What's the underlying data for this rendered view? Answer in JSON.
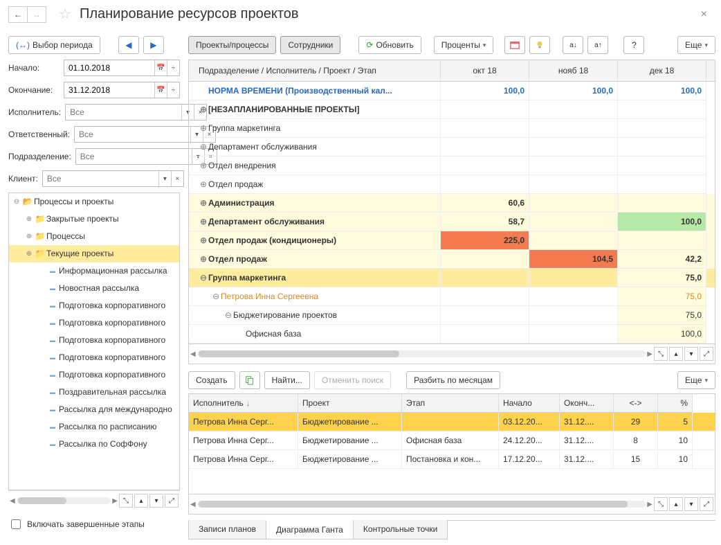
{
  "title": "Планирование ресурсов проектов",
  "toolbar_left": {
    "period_select": "Выбор периода"
  },
  "toolbar_main": {
    "projects": "Проекты/процессы",
    "employees": "Сотрудники",
    "refresh": "Обновить",
    "percents": "Проценты",
    "more": "Еще"
  },
  "period": {
    "start_label": "Начало:",
    "start_value": "01.10.2018",
    "end_label": "Окончание:",
    "end_value": "31.12.2018"
  },
  "filters": {
    "exec_label": "Исполнитель:",
    "resp_label": "Ответственный:",
    "dept_label": "Подразделение:",
    "client_label": "Клиент:",
    "placeholder": "Все"
  },
  "tree": {
    "root": "Процессы и проекты",
    "items": [
      {
        "label": "Закрытые проекты",
        "icon": "folder",
        "exp": "+"
      },
      {
        "label": "Процессы",
        "icon": "folder",
        "exp": "+"
      },
      {
        "label": "Текущие проекты",
        "icon": "folder",
        "exp": "+",
        "sel": true
      },
      {
        "label": "Информационная рассылка",
        "icon": "list"
      },
      {
        "label": "Новостная рассылка",
        "icon": "list"
      },
      {
        "label": "Подготовка корпоративного",
        "icon": "list"
      },
      {
        "label": "Подготовка корпоративного",
        "icon": "list"
      },
      {
        "label": "Подготовка корпоративного",
        "icon": "list"
      },
      {
        "label": "Подготовка корпоративного",
        "icon": "list"
      },
      {
        "label": "Подготовка корпоративного",
        "icon": "list"
      },
      {
        "label": "Поздравительная рассылка",
        "icon": "list"
      },
      {
        "label": "Рассылка для международно",
        "icon": "list"
      },
      {
        "label": "Рассылка по расписанию",
        "icon": "list"
      },
      {
        "label": "Рассылка по СофФону",
        "icon": "list"
      }
    ]
  },
  "include_completed": "Включать завершенные этапы",
  "grid": {
    "head": {
      "main": "Подразделение / Исполнитель / Проект / Этап",
      "m1": "окт 18",
      "m2": "нояб 18",
      "m3": "дек 18"
    },
    "rows": [
      {
        "label": "НОРМА ВРЕМЕНИ (Производственный кал...",
        "v1": "100,0",
        "v2": "100,0",
        "v3": "100,0",
        "style": "blue",
        "indent": 0,
        "exp": ""
      },
      {
        "label": "[НЕЗАПЛАНИРОВАННЫЕ ПРОЕКТЫ]",
        "style": "bold",
        "indent": 0,
        "exp": "⊕"
      },
      {
        "label": "Группа маркетинга",
        "indent": 0,
        "exp": "⊕"
      },
      {
        "label": "Департамент обслуживания",
        "indent": 0,
        "exp": "⊕"
      },
      {
        "label": "Отдел внедрения",
        "indent": 0,
        "exp": "⊕"
      },
      {
        "label": "Отдел продаж",
        "indent": 0,
        "exp": "⊕"
      },
      {
        "label": "Администрация",
        "style": "bold",
        "indent": 0,
        "exp": "⊕",
        "bg": "row-yellow",
        "v1": "60,6",
        "c1": "cell-ly"
      },
      {
        "label": "Департамент обслуживания",
        "style": "bold",
        "indent": 0,
        "exp": "⊕",
        "bg": "row-yellow",
        "v1": "58,7",
        "c1": "cell-ly",
        "v3": "100,0",
        "c3": "cell-green"
      },
      {
        "label": "Отдел продаж (кондиционеры)",
        "style": "bold",
        "indent": 0,
        "exp": "⊕",
        "bg": "row-yellow",
        "v1": "225,0",
        "c1": "cell-orange"
      },
      {
        "label": "Отдел продаж",
        "style": "bold",
        "indent": 0,
        "exp": "⊕",
        "bg": "row-yellow",
        "v2": "104,5",
        "c2": "cell-orange",
        "v3": "42,2",
        "c3": "cell-ly"
      },
      {
        "label": "Группа маркетинга",
        "style": "bold",
        "indent": 0,
        "exp": "⊖",
        "bg": "row-yellow-strong",
        "v3": "75,0",
        "c3": "cell-ly"
      },
      {
        "label": "Петрова Инна Сергеевна",
        "style": "row-orange",
        "indent": 1,
        "exp": "⊖",
        "v3": "75,0",
        "c3": "cell-ly"
      },
      {
        "label": "Бюджетирование проектов",
        "indent": 2,
        "exp": "⊖",
        "v3": "75,0",
        "c3": "cell-ly"
      },
      {
        "label": "Офисная база",
        "indent": 3,
        "v3": "100,0",
        "c3": "cell-ly"
      }
    ]
  },
  "lower_toolbar": {
    "create": "Создать",
    "find": "Найти...",
    "cancel": "Отменить поиск",
    "split": "Разбить по месяцам",
    "more": "Еще"
  },
  "lower_grid": {
    "head": {
      "exec": "Исполнитель",
      "proj": "Проект",
      "stage": "Этап",
      "start": "Начало",
      "end": "Оконч...",
      "dur": "<->",
      "pct": "%"
    },
    "rows": [
      {
        "exec": "Петрова Инна Серг...",
        "proj": "Бюджетирование ...",
        "stage": "",
        "start": "03.12.20...",
        "end": "31.12....",
        "dur": "29",
        "pct": "5",
        "sel": true
      },
      {
        "exec": "Петрова Инна Серг...",
        "proj": "Бюджетирование ...",
        "stage": "Офисная база",
        "start": "24.12.20...",
        "end": "31.12....",
        "dur": "8",
        "pct": "10"
      },
      {
        "exec": "Петрова Инна Серг...",
        "proj": "Бюджетирование ...",
        "stage": "Постановка и кон...",
        "start": "17.12.20...",
        "end": "31.12....",
        "dur": "15",
        "pct": "10"
      }
    ]
  },
  "tabs": {
    "t1": "Записи планов",
    "t2": "Диаграмма Ганта",
    "t3": "Контрольные точки"
  }
}
